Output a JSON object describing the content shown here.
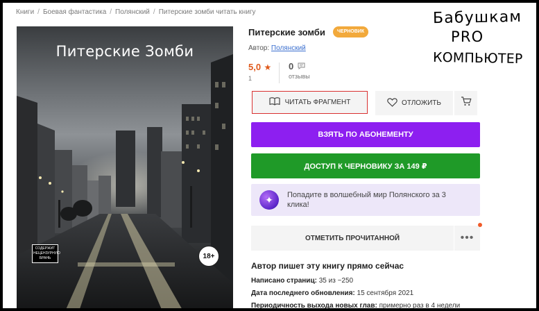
{
  "breadcrumbs": [
    "Книги",
    "Боевая фантастика",
    "Полянский",
    "Питерские зомби читать книгу"
  ],
  "cover": {
    "title": "Питерские Зомби",
    "age_rating": "18+",
    "warning_label": "СОДЕРЖИТ НЕЦЕНЗУРНУЮ БРАНЬ"
  },
  "book": {
    "title": "Питерские зомби",
    "badge": "ЧЕРНОВИК",
    "author_label": "Автор:",
    "author_name": "Полянский"
  },
  "rating": {
    "value": "5,0",
    "count": "1"
  },
  "reviews": {
    "value": "0",
    "label": "отзывы"
  },
  "buttons": {
    "read_fragment": "ЧИТАТЬ ФРАГМЕНТ",
    "defer": "ОТЛОЖИТЬ",
    "subscribe": "ВЗЯТЬ ПО АБОНЕМЕНТУ",
    "draft_access": "ДОСТУП К ЧЕРНОВИКУ ЗА 149 ₽",
    "mark_read": "ОТМЕТИТЬ ПРОЧИТАННОЙ"
  },
  "promo": {
    "text": "Попадите в волшебный мир Полянского за 3 клика!"
  },
  "writing": {
    "heading": "Автор пишет эту книгу прямо сейчас",
    "pages_label": "Написано страниц:",
    "pages_value": "35 из ~250",
    "updated_label": "Дата последнего обновления:",
    "updated_value": "15 сентября 2021",
    "period_label": "Периодичность выхода новых глав:",
    "period_value": "примерно раз в 4 недели"
  },
  "handwriting": {
    "line1": "Бабушкам",
    "line2": "PRO",
    "line3": "КОМПЬЮТЕР"
  },
  "colors": {
    "accent_orange": "#e05a1c",
    "subscribe_purple": "#8d1ff0",
    "draft_green": "#1f9a28",
    "draft_badge": "#f2a93b"
  }
}
